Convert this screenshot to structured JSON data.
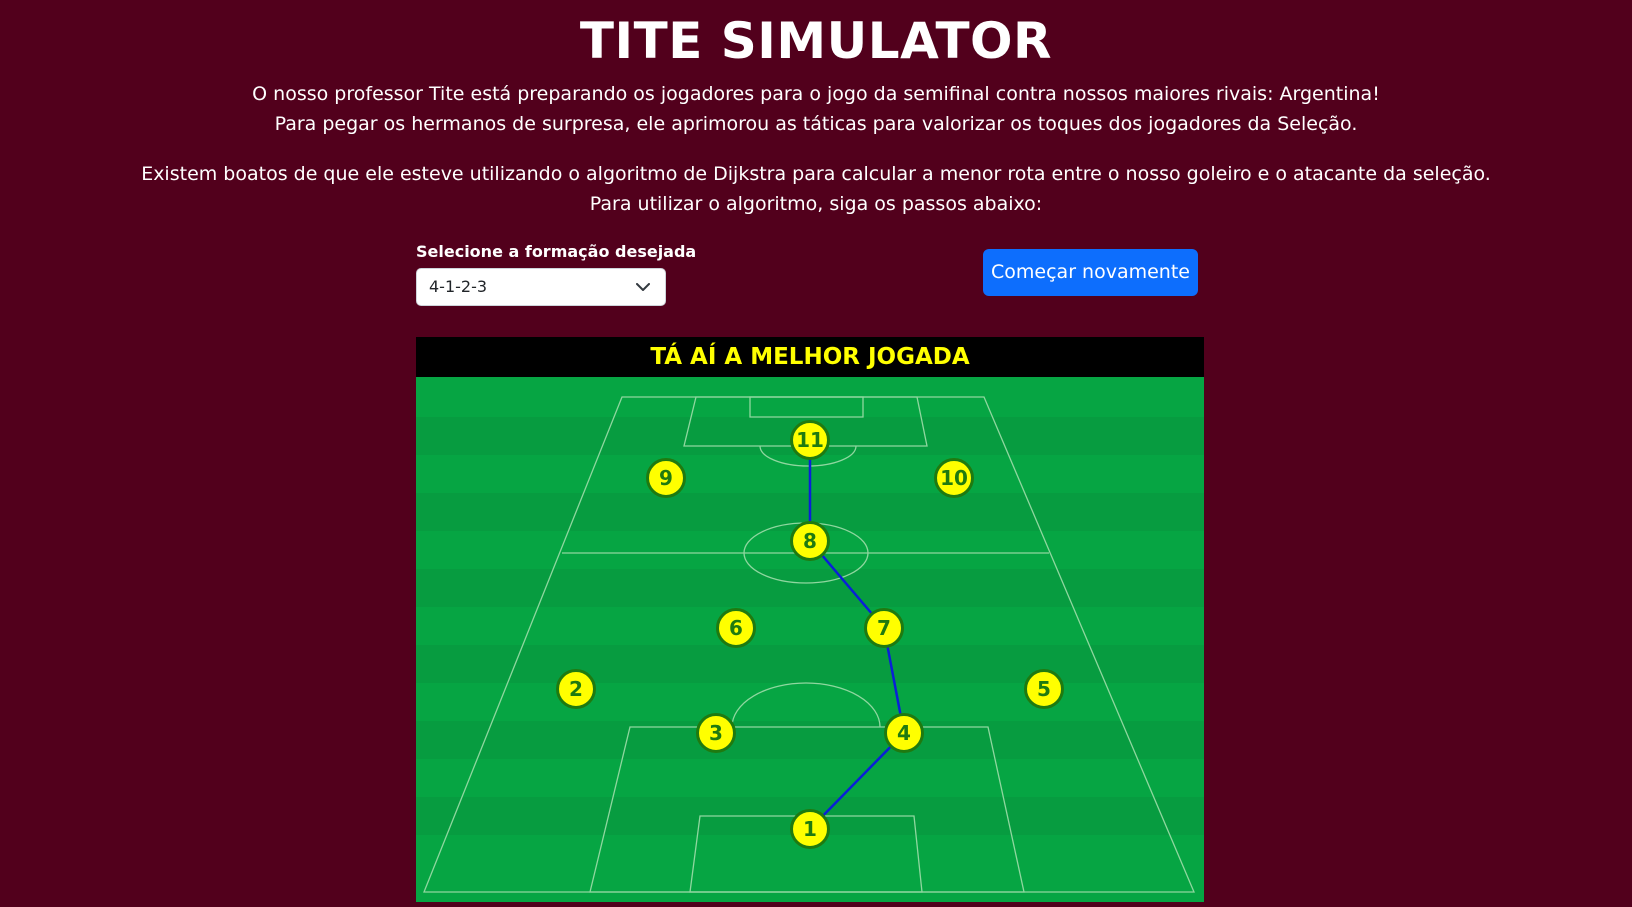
{
  "header": {
    "title": "TITE SIMULATOR"
  },
  "intro": {
    "line1": "O nosso professor Tite está preparando os jogadores para o jogo da semifinal contra nossos maiores rivais: Argentina!",
    "line2": "Para pegar os hermanos de surpresa, ele aprimorou as táticas para valorizar os toques dos jogadores da Seleção.",
    "line3": "Existem boatos de que ele esteve utilizando o algoritmo de Dijkstra para calcular a menor rota entre o nosso goleiro e o atacante da seleção.",
    "line4": "Para utilizar o algoritmo, siga os passos abaixo:"
  },
  "controls": {
    "formation_label": "Selecione a formação desejada",
    "formation_value": "4-1-2-3",
    "restart_label": "Começar novamente"
  },
  "board": {
    "title": "TÁ AÍ A MELHOR JOGADA"
  },
  "players": [
    {
      "number": "1"
    },
    {
      "number": "2"
    },
    {
      "number": "3"
    },
    {
      "number": "4"
    },
    {
      "number": "5"
    },
    {
      "number": "6"
    },
    {
      "number": "7"
    },
    {
      "number": "8"
    },
    {
      "number": "9"
    },
    {
      "number": "10"
    },
    {
      "number": "11"
    }
  ],
  "best_path": [
    "1",
    "4",
    "7",
    "8",
    "11"
  ],
  "colors": {
    "background": "#52001c",
    "pitch": "#06a543",
    "player_fill": "#ffff00",
    "player_border": "#1f7a10",
    "path_line": "#0a1fd8",
    "button": "#0d6efd",
    "header_text": "#ffff00"
  }
}
